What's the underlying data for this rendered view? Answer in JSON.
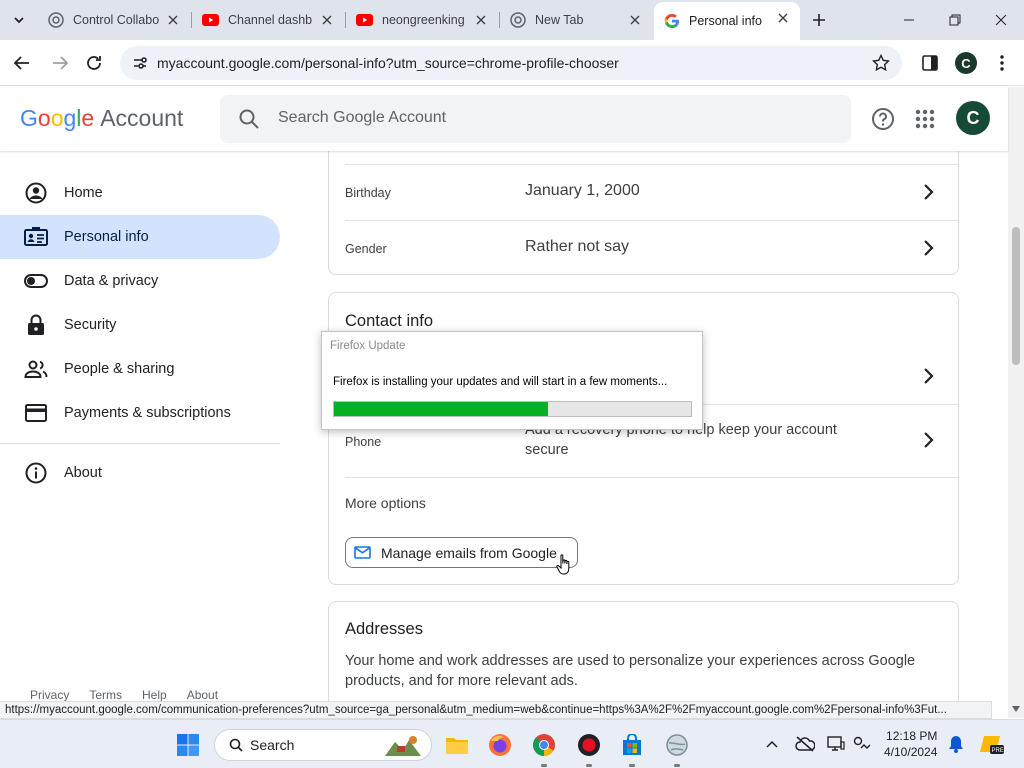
{
  "browser": {
    "tabs": [
      {
        "title": "Control Collabo",
        "icon": "chrome-icon"
      },
      {
        "title": "Channel dashb",
        "icon": "youtube-icon"
      },
      {
        "title": "neongreenking",
        "icon": "youtube-icon"
      },
      {
        "title": "New Tab",
        "icon": "chrome-icon"
      },
      {
        "title": "Personal info",
        "icon": "google-g-icon",
        "active": true
      }
    ],
    "address": "myaccount.google.com/personal-info?utm_source=chrome-profile-chooser",
    "profile_initial": "C"
  },
  "header": {
    "logo_google": [
      "G",
      "o",
      "o",
      "g",
      "l",
      "e"
    ],
    "logo_colors": [
      "#4285F4",
      "#EA4335",
      "#FBBC05",
      "#4285F4",
      "#34A853",
      "#EA4335"
    ],
    "logo_account": "Account",
    "search_placeholder": "Search Google Account",
    "avatar_initial": "C"
  },
  "sidebar": {
    "items": [
      {
        "label": "Home",
        "icon": "account-circle-icon"
      },
      {
        "label": "Personal info",
        "icon": "id-card-icon",
        "active": true
      },
      {
        "label": "Data & privacy",
        "icon": "toggle-icon"
      },
      {
        "label": "Security",
        "icon": "lock-icon"
      },
      {
        "label": "People & sharing",
        "icon": "people-icon"
      },
      {
        "label": "Payments & subscriptions",
        "icon": "credit-card-icon"
      },
      {
        "label": "About",
        "icon": "info-icon"
      }
    ],
    "footer": [
      "Privacy",
      "Terms",
      "Help",
      "About"
    ]
  },
  "main": {
    "basic_rows": [
      {
        "label": "Birthday",
        "value": "January 1, 2000"
      },
      {
        "label": "Gender",
        "value": "Rather not say"
      }
    ],
    "contact": {
      "title": "Contact info",
      "phone_label": "Phone",
      "phone_value_line1": "Add a recovery phone to help keep your account",
      "phone_value_line2": "secure",
      "more_options": "More options",
      "manage_button": "Manage emails from Google"
    },
    "addresses": {
      "title": "Addresses",
      "desc_line1": "Your home and work addresses are used to personalize your experiences across Google",
      "desc_line2": "products, and for more relevant ads."
    }
  },
  "firefox_dialog": {
    "title": "Firefox Update",
    "message": "Firefox is installing your updates and will start in a few moments...",
    "progress": 0.6
  },
  "status_url": "https://myaccount.google.com/communication-preferences?utm_source=ga_personal&utm_medium=web&continue=https%3A%2F%2Fmyaccount.google.com%2Fpersonal-info%3Fut...",
  "taskbar": {
    "search_label": "Search",
    "time": "12:18 PM",
    "date": "4/10/2024"
  },
  "colors": {
    "active_nav": "#d3e3fd",
    "progress_fill": "#06b025",
    "avatar": "#174a36"
  }
}
